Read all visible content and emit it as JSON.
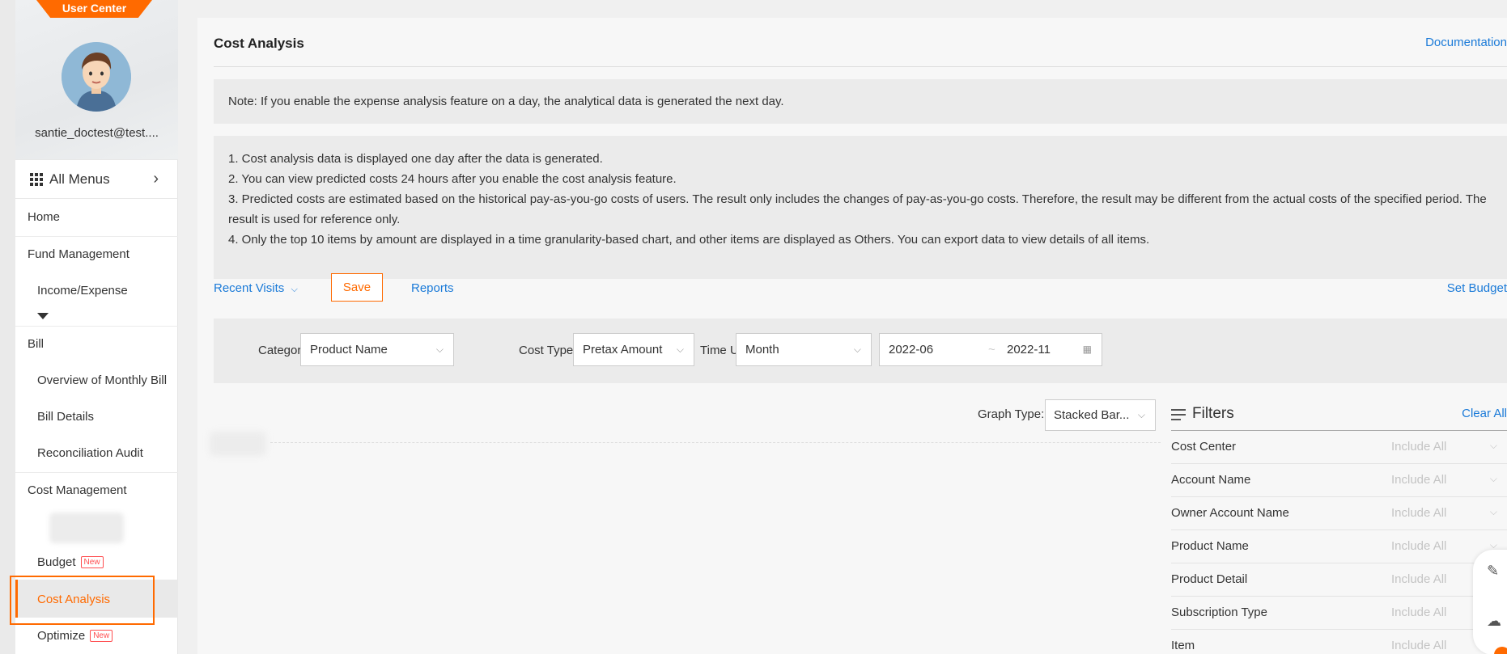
{
  "sidebar": {
    "user_center": "User Center",
    "username": "santie_doctest@test....",
    "all_menus": "All Menus",
    "items": {
      "home": "Home",
      "fund_management": "Fund Management",
      "income_expense": "Income/Expense",
      "bill": "Bill",
      "overview_monthly_bill": "Overview of Monthly Bill",
      "bill_details": "Bill Details",
      "reconciliation_audit": "Reconciliation Audit",
      "cost_management": "Cost Management",
      "budget": "Budget",
      "cost_analysis": "Cost Analysis",
      "optimize": "Optimize"
    },
    "new_badge": "New",
    "active_color": "#ff6a00"
  },
  "main": {
    "title": "Cost Analysis",
    "documentation": "Documentation",
    "note": "Note: If you enable the expense analysis feature on a day, the analytical data is generated the next day.",
    "info_lines": [
      "1. Cost analysis data is displayed one day after the data is generated.",
      "2. You can view predicted costs 24 hours after you enable the cost analysis feature.",
      "3. Predicted costs are estimated based on the historical pay-as-you-go costs of users. The result only includes the changes of pay-as-you-go costs. Therefore, the result may be different from the actual costs of the specified period. The result is used for reference only.",
      "4. Only the top 10 items by amount are displayed in a time granularity-based chart, and other items are displayed as Others. You can export data to view details of all items."
    ],
    "toolbar": {
      "recent_visits": "Recent Visits",
      "save": "Save",
      "reports": "Reports",
      "set_budget": "Set Budget"
    },
    "filter_bar": {
      "category_label": "Category:",
      "category_value": "Product Name",
      "cost_type_label": "Cost Type:",
      "cost_type_value": "Pretax Amount",
      "time_unit_label": "Time Unit:",
      "time_unit_value": "Month",
      "date_start": "2022-06",
      "date_end": "2022-11"
    },
    "graph_type_label": "Graph Type:",
    "graph_type_value": "Stacked Bar...",
    "filters": {
      "title": "Filters",
      "clear_all": "Clear All",
      "rows": [
        {
          "name": "Cost Center",
          "value": "Include All"
        },
        {
          "name": "Account Name",
          "value": "Include All"
        },
        {
          "name": "Owner Account Name",
          "value": "Include All"
        },
        {
          "name": "Product Name",
          "value": "Include All"
        },
        {
          "name": "Product Detail",
          "value": "Include All"
        },
        {
          "name": "Subscription Type",
          "value": "Include All"
        },
        {
          "name": "Item",
          "value": "Include All"
        }
      ]
    },
    "link_color": "#1a7ad8"
  }
}
